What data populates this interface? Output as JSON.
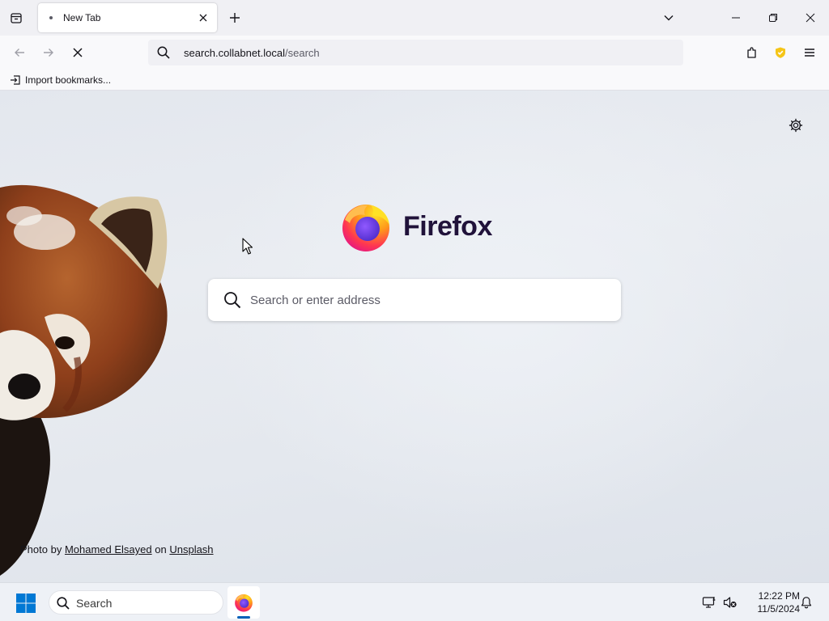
{
  "tabs": [
    {
      "title": "New Tab"
    }
  ],
  "navbar": {
    "url_host": "search.collabnet.local",
    "url_path": "/search"
  },
  "bookmarks": {
    "import_label": "Import bookmarks..."
  },
  "newtab": {
    "brand": "Firefox",
    "search_placeholder": "Search or enter address",
    "credit_prefix": "Photo by",
    "credit_author": "Mohamed Elsayed",
    "credit_on": "on",
    "credit_source": "Unsplash"
  },
  "taskbar": {
    "search_label": "Search",
    "time": "12:22 PM",
    "date": "11/5/2024"
  },
  "colors": {
    "accent": "#005fb8",
    "brand_text": "#20123a",
    "shield": "#f5c518"
  },
  "icons": [
    "tab-list-icon",
    "close-icon",
    "plus-icon",
    "chevron-down-icon",
    "minimize-icon",
    "maximize-icon",
    "back-arrow-icon",
    "forward-arrow-icon",
    "stop-icon",
    "search-icon",
    "extensions-icon",
    "shield-icon",
    "hamburger-menu-icon",
    "import-icon",
    "gear-icon",
    "firefox-logo",
    "windows-start-icon",
    "network-icon",
    "volume-muted-icon",
    "bell-icon"
  ]
}
